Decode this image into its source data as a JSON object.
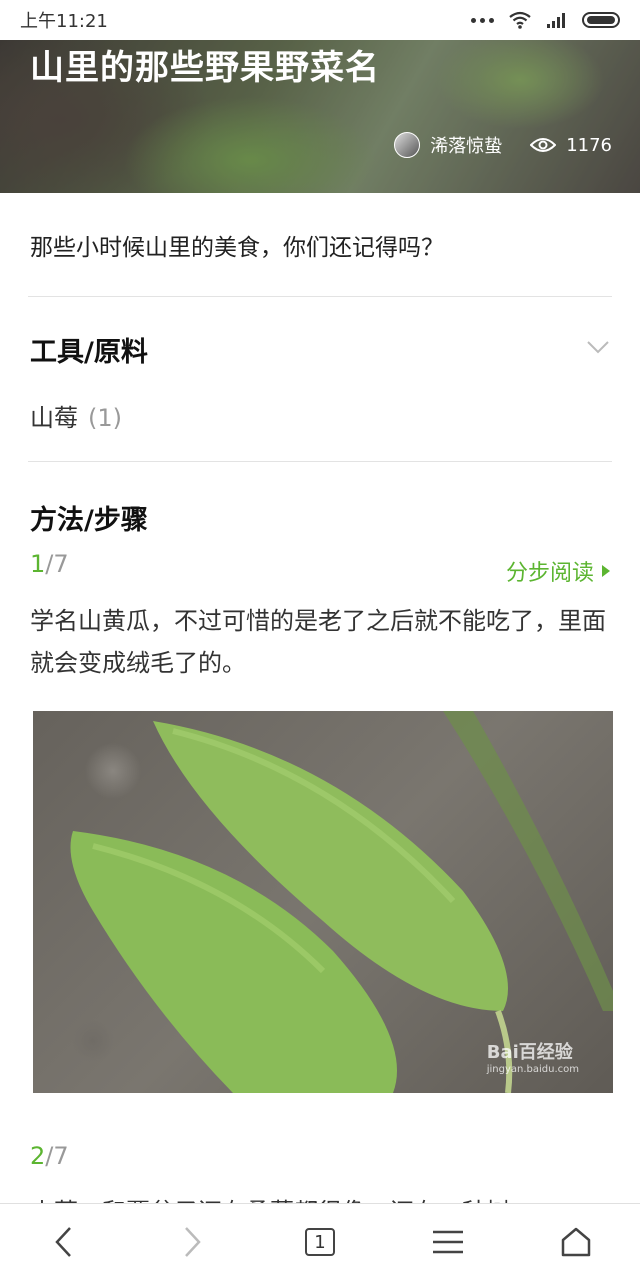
{
  "status_bar": {
    "time": "上午11:21"
  },
  "article": {
    "title": "山里的那些野果野菜名",
    "author": "浠落惊蛰",
    "views": "1176",
    "intro": "那些小时候山里的美食，你们还记得吗？"
  },
  "tools": {
    "heading": "工具/原料",
    "items": [
      {
        "name": "山莓",
        "count": "(1)"
      }
    ]
  },
  "steps": {
    "heading": "方法/步骤",
    "read_label": "分步阅读",
    "items": [
      {
        "current": "1",
        "total": "/7",
        "text": "学名山黄瓜，不过可惜的是老了之后就不能吃了，里面就会变成绒毛了的。",
        "watermark": "Bai百经验",
        "watermark_url": "jingyan.baidu.com"
      },
      {
        "current": "2",
        "total": "/7",
        "text": "山莓，和覆盆子还有桑葚都很像，还有一种树"
      }
    ]
  },
  "bottom_nav": {
    "tab_count": "1"
  },
  "icons": {
    "status": [
      "more-dots-icon",
      "wifi-icon",
      "signal-icon",
      "battery-icon"
    ],
    "nav": [
      "back-icon",
      "forward-icon",
      "tabs-icon",
      "menu-icon",
      "home-icon"
    ]
  },
  "colors": {
    "accent": "#5cb531",
    "text": "#333333",
    "muted": "#999999"
  }
}
